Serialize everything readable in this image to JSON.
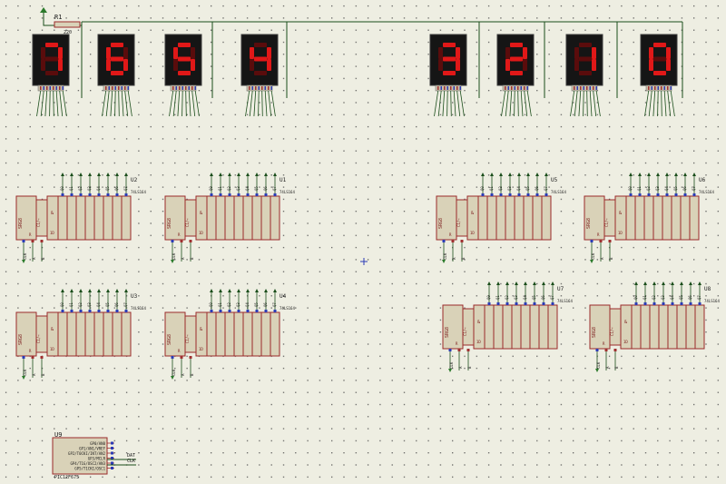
{
  "schematic": {
    "resistor": {
      "ref": "R1",
      "value": "220"
    },
    "displays": [
      "7",
      "6",
      "5",
      "4",
      "3",
      "2",
      "1",
      "0"
    ],
    "shift_registers": [
      {
        "ref": "U2",
        "part": "74LS164"
      },
      {
        "ref": "U1",
        "part": "74LS164"
      },
      {
        "ref": "U5",
        "part": "74LS164"
      },
      {
        "ref": "U6",
        "part": "74LS164"
      },
      {
        "ref": "U3",
        "part": "74LS164"
      },
      {
        "ref": "U4",
        "part": "74LS164"
      },
      {
        "ref": "U7",
        "part": "74LS164"
      },
      {
        "ref": "U8",
        "part": "74LS164"
      }
    ],
    "register_pins": {
      "left": [
        "SRG8",
        "R",
        "C1/→",
        "&",
        "1D"
      ],
      "outputs": [
        "Q0",
        "Q1",
        "Q2",
        "Q3",
        "Q4",
        "Q5",
        "Q6",
        "Q7"
      ],
      "inputs": [
        "CLK",
        "A",
        "B"
      ]
    },
    "mcu": {
      "ref": "U9",
      "part": "PIC12F675",
      "pins": [
        "GP0/AN0",
        "GP1/AN1/VREF",
        "GP2/T0CKI/INT/AN2",
        "GP3/MCLR",
        "GP4/T1G/OSC2/AN3",
        "GP5/T1CKI/OSC1"
      ],
      "nets": [
        "DAT",
        "CLK"
      ]
    }
  },
  "colors": {
    "background": "#eeeee2",
    "grid_dot": "#4a4a4a",
    "wire": "#1a4d1a",
    "chip_fill": "#d9d2b8",
    "chip_border": "#9a2a2a",
    "display_body": "#151515",
    "segment_on": "#e01818",
    "segment_off": "#5a0c0c",
    "pin_blue": "#2b3bb5",
    "power_green": "#2b7a2b"
  }
}
